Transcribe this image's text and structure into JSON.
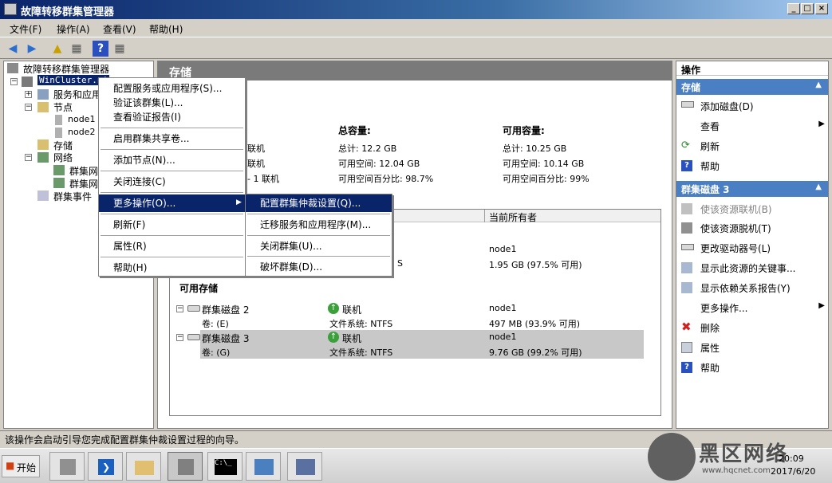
{
  "window": {
    "title": "故障转移群集管理器"
  },
  "menubar": [
    "文件(F)",
    "操作(A)",
    "查看(V)",
    "帮助(H)"
  ],
  "tree": {
    "root": "故障转移群集管理器",
    "cluster": "WinCluster.ni",
    "services": "服务和应用",
    "nodes": "节点",
    "node1": "node1",
    "node2": "node2",
    "storage": "存储",
    "network": "网络",
    "net1": "群集网",
    "net2": "群集网",
    "events": "群集事件"
  },
  "center": {
    "header": "存储",
    "online1": "联机",
    "online2": "联机",
    "online3": "- 1 联机",
    "total_title": "总容量:",
    "total_total": "总计: 12.2 GB",
    "total_free": "可用空间: 12.04 GB",
    "total_pct": "可用空间百分比: 98.7%",
    "avail_title": "可用容量:",
    "avail_total": "总计: 10.25 GB",
    "avail_free": "可用空间: 10.14 GB",
    "avail_pct": "可用空间百分比: 99%",
    "col_owner": "当前所有者",
    "witness_owner": "node1",
    "witness_fs": "S",
    "witness_cap": "1.95 GB (97.5% 可用)",
    "available_storage": "可用存储",
    "disk2_name": "群集磁盘 2",
    "disk2_status": "联机",
    "disk2_owner": "node1",
    "disk2_vol": "卷: (E)",
    "disk2_fs": "文件系统: NTFS",
    "disk2_cap": "497 MB (93.9% 可用)",
    "disk3_name": "群集磁盘 3",
    "disk3_status": "联机",
    "disk3_owner": "node1",
    "disk3_vol": "卷: (G)",
    "disk3_fs": "文件系统: NTFS",
    "disk3_cap": "9.76 GB (99.2% 可用)"
  },
  "actions": {
    "pane_title": "操作",
    "sec1": "存储",
    "sec1_items": [
      "添加磁盘(D)",
      "查看",
      "刷新",
      "帮助"
    ],
    "sec2": "群集磁盘 3",
    "sec2_items": [
      "使该资源联机(B)",
      "使该资源脱机(T)",
      "更改驱动器号(L)",
      "显示此资源的关键事...",
      "显示依赖关系报告(Y)",
      "更多操作...",
      "删除",
      "属性",
      "帮助"
    ]
  },
  "context_menu": [
    "配置服务或应用程序(S)...",
    "验证该群集(L)...",
    "查看验证报告(I)",
    "启用群集共享卷...",
    "添加节点(N)...",
    "关闭连接(C)",
    "更多操作(O)...",
    "刷新(F)",
    "属性(R)",
    "帮助(H)"
  ],
  "submenu": [
    "配置群集仲裁设置(Q)...",
    "迁移服务和应用程序(M)...",
    "关闭群集(U)...",
    "破坏群集(D)..."
  ],
  "statusbar": {
    "text": "该操作会启动引导您完成配置群集仲裁设置过程的向导。"
  },
  "taskbar": {
    "start": "开始",
    "time": "20:09",
    "date": "2017/6/20"
  },
  "watermark": {
    "text": "黑区网络",
    "url": "www.hqcnet.com"
  },
  "colors": {
    "titlebar": "#0a246a",
    "highlight": "#0a246a",
    "action_header": "#4a7fc4",
    "selected_row": "#c8c8c8"
  }
}
